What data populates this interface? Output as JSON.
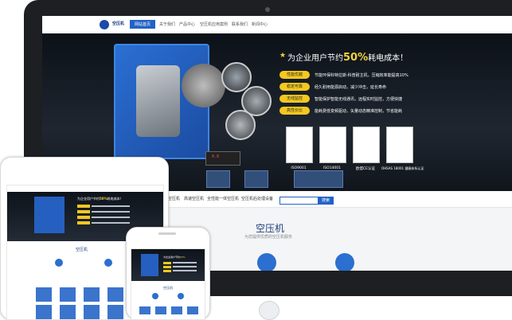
{
  "desktop": {
    "logo_text": "空压机",
    "nav": [
      "网站首页",
      "关于我们",
      "产品中心",
      "空压机应用案例",
      "联系我们",
      "新闻中心"
    ],
    "hero": {
      "headline_prefix": "为企业用户节约",
      "headline_pct": "50%",
      "headline_suffix": "耗电成本！",
      "features": [
        {
          "tag": "性能优越",
          "text": "节能环保科特拉斯·科普耐主机，压缩效率能提高10%"
        },
        {
          "tag": "稳定可靠",
          "text": "经久耐用能源启动，减少冲击，延长寿命"
        },
        {
          "tag": "无线监控",
          "text": "智能保护智能无线通讯，远程实时监控，方便快捷"
        },
        {
          "tag": "高性价比",
          "text": "能耗费低变频驱动，矢量动态精准控制，节省能耗"
        }
      ],
      "certificates": [
        "ISO9001",
        "ISO14001",
        "欧盟CE认证",
        "OHSAS 18001 健康体系认证"
      ],
      "panel_digits": "0.8"
    },
    "subnav": [
      "空压机",
      "高速空压机",
      "全性能一体空压机",
      "空压机后处理设备"
    ],
    "search": {
      "button": "搜索"
    },
    "section": {
      "title": "空压机",
      "subtitle": "为您提供优质的空压机服务"
    }
  },
  "tablet": {
    "headline_prefix": "为企业用户节约",
    "headline_pct": "50%",
    "headline_suffix": "耗电成本！",
    "section_title": "空压机"
  },
  "phone": {
    "headline_prefix": "为企业用户节约",
    "headline_pct": "50%",
    "section_title": "空压机"
  },
  "colors": {
    "accent": "#2262c6",
    "highlight": "#f4c820",
    "frame": "#1d1f22"
  }
}
